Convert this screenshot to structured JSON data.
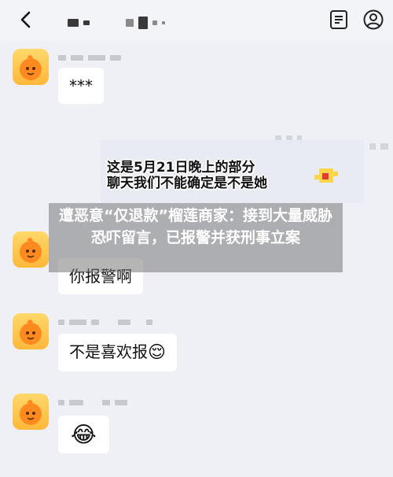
{
  "header": {
    "back_icon": "chevron-left-icon",
    "title_obscured": true,
    "icons": [
      "document-list-icon",
      "profile-icon"
    ]
  },
  "messages": [
    {
      "text": "***"
    },
    {
      "screenshot_caption_line1": "这是5月21日晚上的部分",
      "screenshot_caption_line2": "聊天我们不能确定是不是她"
    },
    {
      "text": "你报警啊"
    },
    {
      "text": "不是喜欢报",
      "emoji": "😌"
    },
    {
      "emoji": "😂"
    }
  ],
  "banner": {
    "text": "遭恶意“仅退款”榴莲商家：接到大量威胁恐吓留言，已报警并获刑事立案"
  },
  "colors": {
    "background": "#eef0f5",
    "avatar": "#ffb83a",
    "bubble": "#ffffff"
  }
}
